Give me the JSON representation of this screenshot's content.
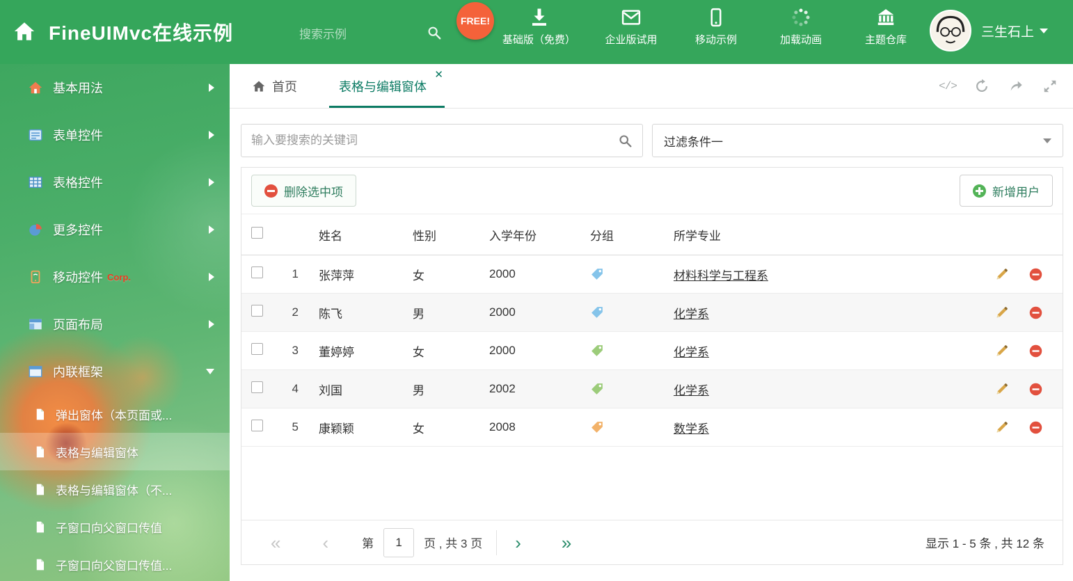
{
  "header": {
    "title": "FineUIMvc在线示例",
    "search_placeholder": "搜索示例",
    "free_badge": "FREE!",
    "nav": [
      {
        "label": "基础版（免费）"
      },
      {
        "label": "企业版试用"
      },
      {
        "label": "移动示例"
      },
      {
        "label": "加载动画"
      },
      {
        "label": "主题仓库"
      }
    ],
    "username": "三生石上"
  },
  "sidebar": {
    "items": [
      {
        "label": "基本用法"
      },
      {
        "label": "表单控件"
      },
      {
        "label": "表格控件"
      },
      {
        "label": "更多控件"
      },
      {
        "label": "移动控件",
        "badge": "Corp."
      },
      {
        "label": "页面布局"
      },
      {
        "label": "内联框架"
      }
    ],
    "subitems": [
      {
        "label": "弹出窗体（本页面或..."
      },
      {
        "label": "表格与编辑窗体"
      },
      {
        "label": "表格与编辑窗体（不..."
      },
      {
        "label": "子窗口向父窗口传值"
      },
      {
        "label": "子窗口向父窗口传值..."
      }
    ]
  },
  "tabs": {
    "home": "首页",
    "active": "表格与编辑窗体",
    "close": "✕"
  },
  "search": {
    "placeholder": "输入要搜索的关键词",
    "filter": "过滤条件一"
  },
  "toolbar": {
    "delete": "删除选中项",
    "add": "新增用户"
  },
  "table": {
    "columns": [
      "姓名",
      "性别",
      "入学年份",
      "分组",
      "所学专业"
    ],
    "rows": [
      {
        "num": "1",
        "name": "张萍萍",
        "gender": "女",
        "year": "2000",
        "tag": "#85c4ea",
        "major": "材料科学与工程系"
      },
      {
        "num": "2",
        "name": "陈飞",
        "gender": "男",
        "year": "2000",
        "tag": "#85c4ea",
        "major": "化学系"
      },
      {
        "num": "3",
        "name": "董婷婷",
        "gender": "女",
        "year": "2000",
        "tag": "#9ccc7a",
        "major": "化学系"
      },
      {
        "num": "4",
        "name": "刘国",
        "gender": "男",
        "year": "2002",
        "tag": "#9ccc7a",
        "major": "化学系"
      },
      {
        "num": "5",
        "name": "康颖颖",
        "gender": "女",
        "year": "2008",
        "tag": "#f2b26a",
        "major": "数学系"
      }
    ]
  },
  "pagination": {
    "page_prefix": "第",
    "page_value": "1",
    "page_suffix": "页 , 共 3 页",
    "summary": "显示 1 - 5 条 , 共 12 条"
  },
  "colors": {
    "accent_green": "#35a65b",
    "tab_active": "#0c7b64"
  }
}
